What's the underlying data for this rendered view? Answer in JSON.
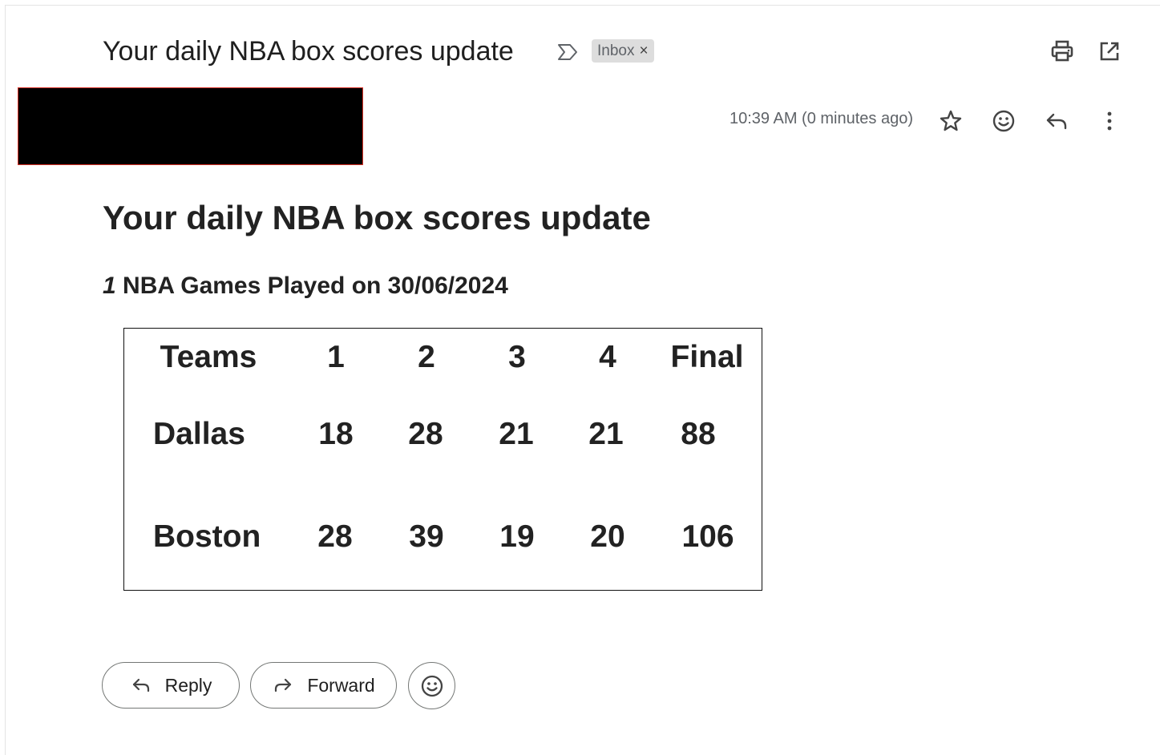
{
  "email": {
    "subject": "Your daily NBA box scores update",
    "label": "Inbox",
    "label_close": "×",
    "timestamp": "10:39 AM (0 minutes ago)"
  },
  "body": {
    "title": "Your daily NBA box scores update",
    "games_count": "1",
    "games_text": " NBA Games Played on 30/06/2024",
    "table": {
      "headers": [
        "Teams",
        "1",
        "2",
        "3",
        "4",
        "Final"
      ],
      "rows": [
        [
          "Dallas",
          "18",
          "28",
          "21",
          "21",
          "88"
        ],
        [
          "Boston",
          "28",
          "39",
          "19",
          "20",
          "106"
        ]
      ]
    }
  },
  "actions": {
    "reply_label": "Reply",
    "forward_label": "Forward"
  },
  "icons": {
    "importance": "importance-marker-icon",
    "print": "print-icon",
    "open_new_window": "open-in-new-icon",
    "star": "star-icon",
    "emoji": "emoji-icon",
    "reply": "reply-icon",
    "more": "more-vert-icon",
    "forward": "forward-icon"
  }
}
